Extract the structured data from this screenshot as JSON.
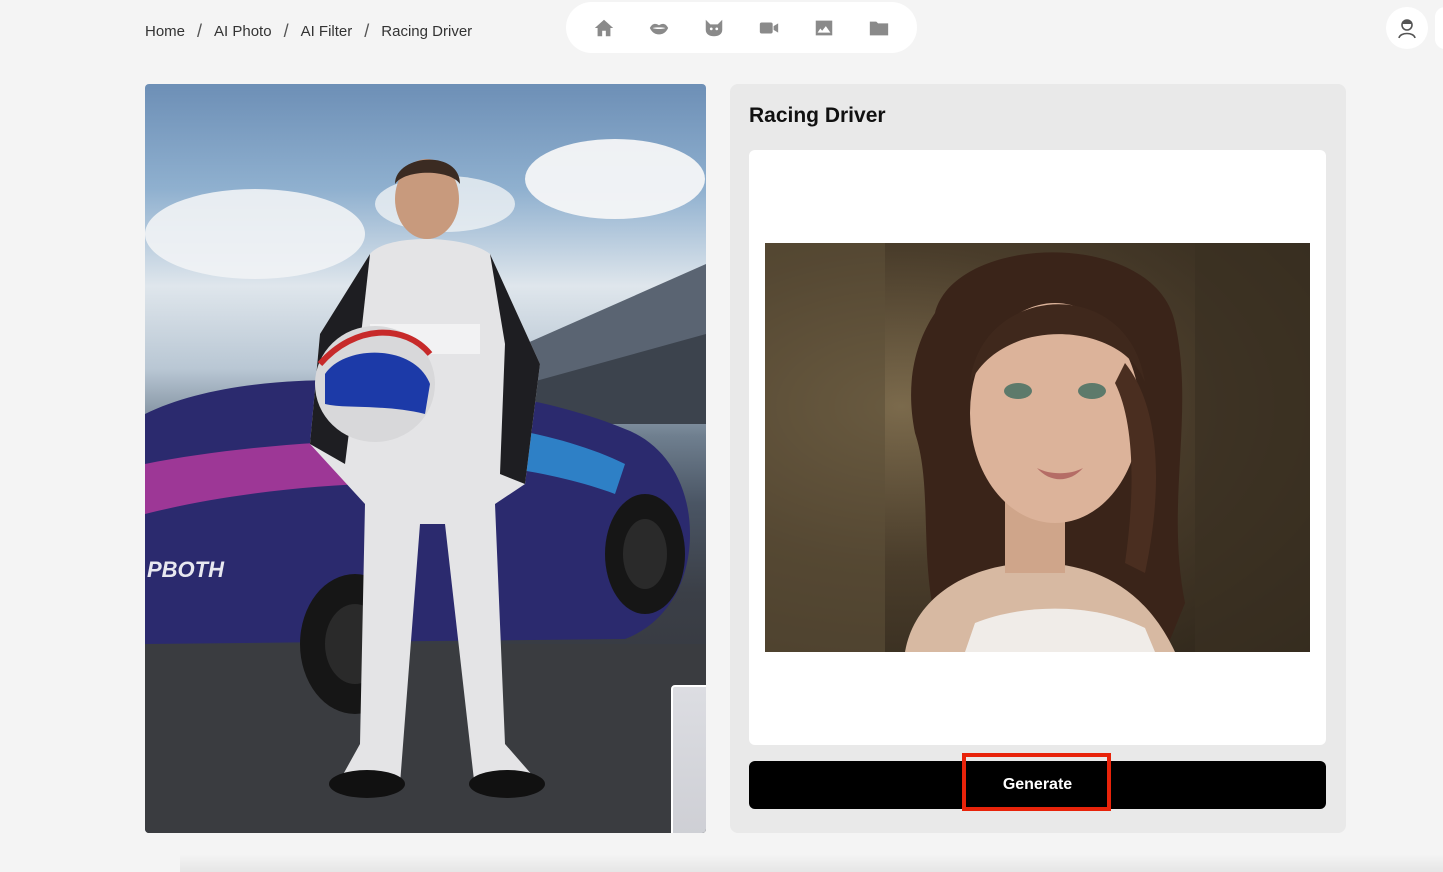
{
  "breadcrumb": {
    "items": [
      "Home",
      "AI Photo",
      "AI Filter",
      "Racing Driver"
    ],
    "separator": "/"
  },
  "tool_nav": {
    "icons": [
      "home-icon",
      "lips-icon",
      "cat-icon",
      "video-icon",
      "image-icon",
      "folder-icon"
    ]
  },
  "user": {
    "avatar_icon": "user-avatar-icon"
  },
  "preview": {
    "template_photo": "racing-driver-template-image",
    "source_photo": "source-face-thumbnail",
    "car_livery_text": "PBOTH"
  },
  "panel": {
    "title": "Racing Driver",
    "uploaded_photo": "uploaded-portrait-image",
    "generate_label": "Generate",
    "highlight_color": "#e8230a"
  }
}
